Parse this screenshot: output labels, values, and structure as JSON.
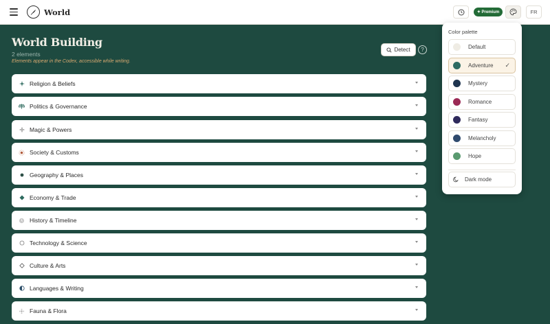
{
  "app": {
    "title": "World"
  },
  "topbar": {
    "premium_label": "✦ Premium",
    "language": "FR"
  },
  "header": {
    "title": "World Building",
    "count": "2 elements",
    "hint": "Elements appear in the Codex, accessible while writing.",
    "detect_label": "Detect",
    "help_label": "?"
  },
  "categories": [
    {
      "label": "Religion & Beliefs",
      "icon": "sparkle-icon"
    },
    {
      "label": "Politics & Governance",
      "icon": "scales-icon"
    },
    {
      "label": "Magic & Powers",
      "icon": "magic-sparkle-icon"
    },
    {
      "label": "Society & Customs",
      "icon": "sun-icon"
    },
    {
      "label": "Geography & Places",
      "icon": "dot-icon"
    },
    {
      "label": "Economy & Trade",
      "icon": "diamond-icon"
    },
    {
      "label": "History & Timeline",
      "icon": "clock-icon"
    },
    {
      "label": "Technology & Science",
      "icon": "circle-icon"
    },
    {
      "label": "Culture & Arts",
      "icon": "diamond-outline-icon"
    },
    {
      "label": "Languages & Writing",
      "icon": "half-circle-icon"
    },
    {
      "label": "Fauna & Flora",
      "icon": "flower-icon"
    }
  ],
  "palette": {
    "heading": "Color palette",
    "selected": "Adventure",
    "options": [
      {
        "label": "Default",
        "color": "#efece4"
      },
      {
        "label": "Adventure",
        "color": "#2e6b61"
      },
      {
        "label": "Mystery",
        "color": "#1f3550"
      },
      {
        "label": "Romance",
        "color": "#9b2a55"
      },
      {
        "label": "Fantasy",
        "color": "#2f2a5c"
      },
      {
        "label": "Melancholy",
        "color": "#2f4a6e"
      },
      {
        "label": "Hope",
        "color": "#5a9a70"
      }
    ],
    "check": "✓",
    "dark_mode_label": "Dark mode"
  },
  "colors": {
    "background": "#1e4a40",
    "premium": "#236b37",
    "hint": "#d8a970"
  }
}
